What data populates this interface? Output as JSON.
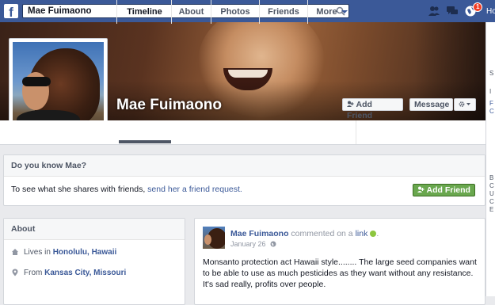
{
  "search": {
    "value": "Mae Fuimaono"
  },
  "topbar": {
    "notifications_badge": "1",
    "home_label": "Ho"
  },
  "profile": {
    "name": "Mae Fuimaono",
    "add_friend_label": "Add Friend",
    "message_label": "Message"
  },
  "nav": {
    "tabs": [
      {
        "label": "Timeline",
        "active": true
      },
      {
        "label": "About"
      },
      {
        "label": "Photos"
      },
      {
        "label": "Friends"
      },
      {
        "label": "More"
      }
    ]
  },
  "know": {
    "title": "Do you know Mae?",
    "text_prefix": "To see what she shares with friends, ",
    "link": "send her a friend request.",
    "button": "Add Friend"
  },
  "about": {
    "title": "About",
    "lives_prefix": "Lives in ",
    "lives_place": "Honolulu, Hawaii",
    "from_prefix": "From ",
    "from_place": "Kansas City, Missouri"
  },
  "post": {
    "author": "Mae Fuimaono",
    "action": " commented on a ",
    "link": "link",
    "date": "January 26",
    "body": "Monsanto protection act Hawaii style........ The large seed companies want to be able to use as much pesticides as they want without any resistance. It's sad really, profits over people."
  },
  "right_sidebar_glimpse": [
    "S",
    "I",
    "F",
    "C",
    "B",
    "C",
    "U",
    "C",
    "E"
  ],
  "colors": {
    "brand_blue": "#3b5998",
    "add_friend_green": "#69a74e",
    "page_bg": "#e9eaed"
  }
}
